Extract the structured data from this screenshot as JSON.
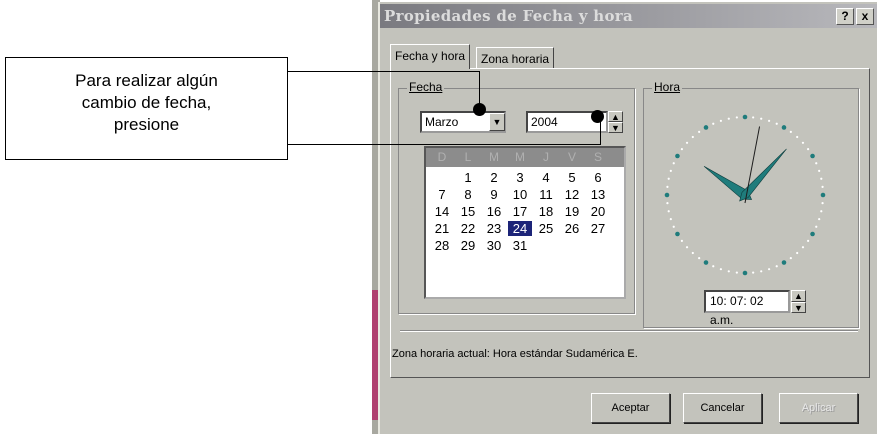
{
  "callout": {
    "lines": [
      "Para realizar algún",
      "cambio de fecha,",
      "presione"
    ]
  },
  "window": {
    "title": "Propiedades de Fecha y hora",
    "help_label": "?",
    "close_label": "x"
  },
  "tabs": [
    {
      "label": "Fecha y hora",
      "active": true
    },
    {
      "label": "Zona horaria",
      "active": false
    }
  ],
  "date_group": {
    "label": "Fecha",
    "month": "Marzo",
    "year": "2004",
    "day_headers": [
      "D",
      "L",
      "M",
      "M",
      "J",
      "V",
      "S"
    ],
    "weeks": [
      [
        "",
        "1",
        "2",
        "3",
        "4",
        "5",
        "6"
      ],
      [
        "7",
        "8",
        "9",
        "10",
        "11",
        "12",
        "13"
      ],
      [
        "14",
        "15",
        "16",
        "17",
        "18",
        "19",
        "20"
      ],
      [
        "21",
        "22",
        "23",
        "24",
        "25",
        "26",
        "27"
      ],
      [
        "28",
        "29",
        "30",
        "31",
        "",
        "",
        ""
      ]
    ],
    "selected_day": "24"
  },
  "time_group": {
    "label": "Hora",
    "time": "10: 07: 02 a.m."
  },
  "timezone": {
    "text": "Zona horaria actual:  Hora estándar Sudamérica E."
  },
  "buttons": {
    "ok": "Aceptar",
    "cancel": "Cancelar",
    "apply": "Aplicar"
  },
  "colors": {
    "selected_day_bg": "#1c2478",
    "clock_hands": "#1f7c7c"
  }
}
